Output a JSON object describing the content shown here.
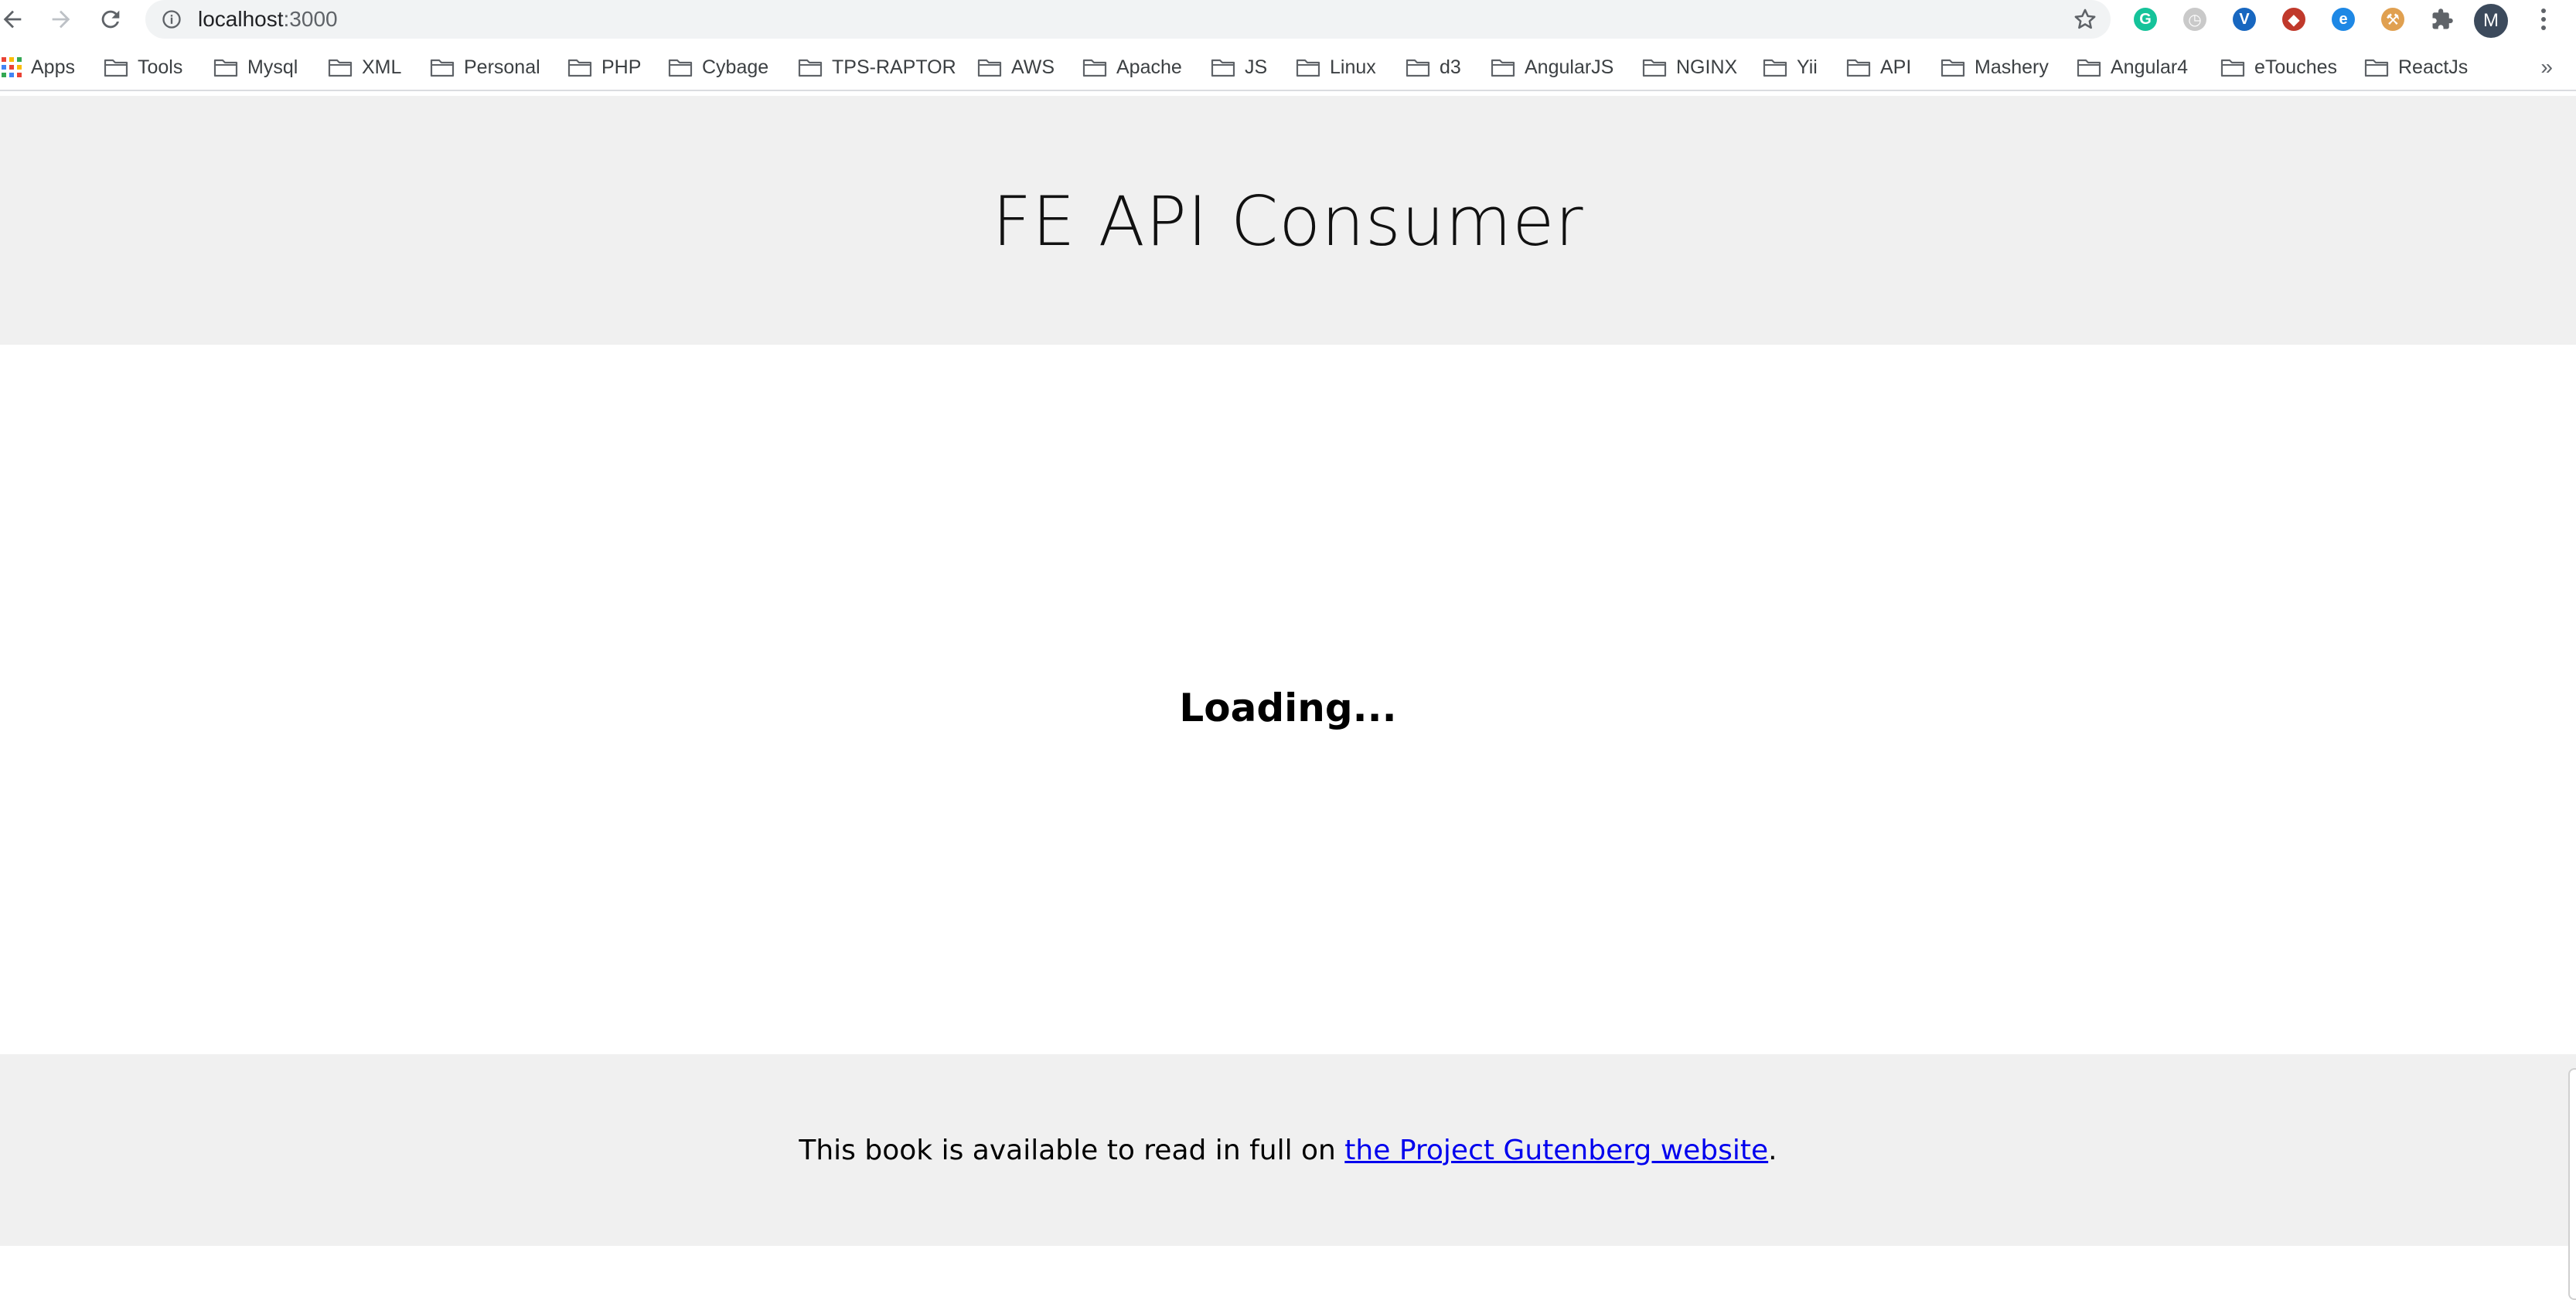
{
  "browser": {
    "url_host": "localhost",
    "url_port": ":3000",
    "avatar_initial": "M",
    "extensions": [
      {
        "name": "grammarly-extension-icon",
        "glyph": "G",
        "color": "#15c39a"
      },
      {
        "name": "timer-extension-icon",
        "glyph": "◷",
        "color": "#c9c9c9"
      },
      {
        "name": "vuetify-extension-icon",
        "glyph": "V",
        "color": "#1867c0"
      },
      {
        "name": "ruby-extension-icon",
        "glyph": "◆",
        "color": "#c0392b"
      },
      {
        "name": "ie-tab-extension-icon",
        "glyph": "e",
        "color": "#1e88e5"
      },
      {
        "name": "hammer-extension-icon",
        "glyph": "⚒",
        "color": "#e0a050"
      }
    ]
  },
  "bookmarks": {
    "apps_label": "Apps",
    "folders": [
      "Tools",
      "Mysql",
      "XML",
      "Personal",
      "PHP",
      "Cybage",
      "TPS-RAPTOR",
      "AWS",
      "Apache",
      "JS",
      "Linux",
      "d3",
      "AngularJS",
      "NGINX",
      "Yii",
      "API",
      "Mashery",
      "Angular4",
      "eTouches",
      "ReactJs"
    ],
    "more": "»"
  },
  "page": {
    "title": "FE API Consumer",
    "loading": "Loading...",
    "footer_prefix": "This book is available to read in full on ",
    "footer_link": "the Project Gutenberg website",
    "footer_suffix": "."
  }
}
